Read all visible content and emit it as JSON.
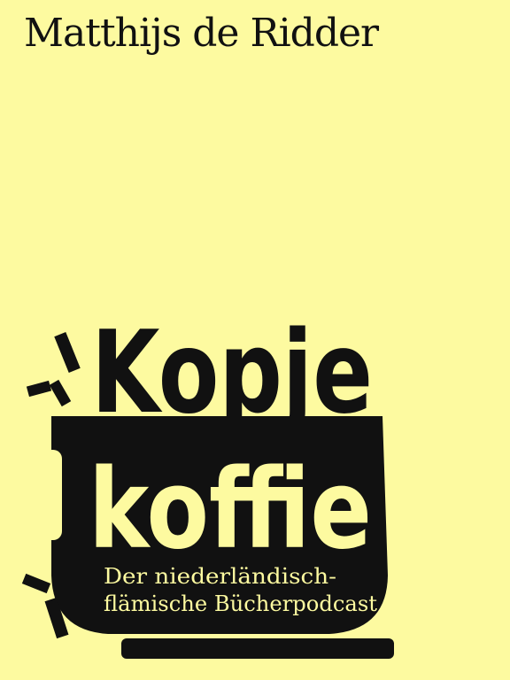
{
  "author": "Matthijs de Ridder",
  "logo": {
    "line1": "Kopje",
    "line2": "koffie",
    "subtitle_line1": "Der niederländisch-",
    "subtitle_line2": "flämische Bücherpodcast"
  },
  "colors": {
    "background": "#fdfaa0",
    "ink": "#111111"
  }
}
